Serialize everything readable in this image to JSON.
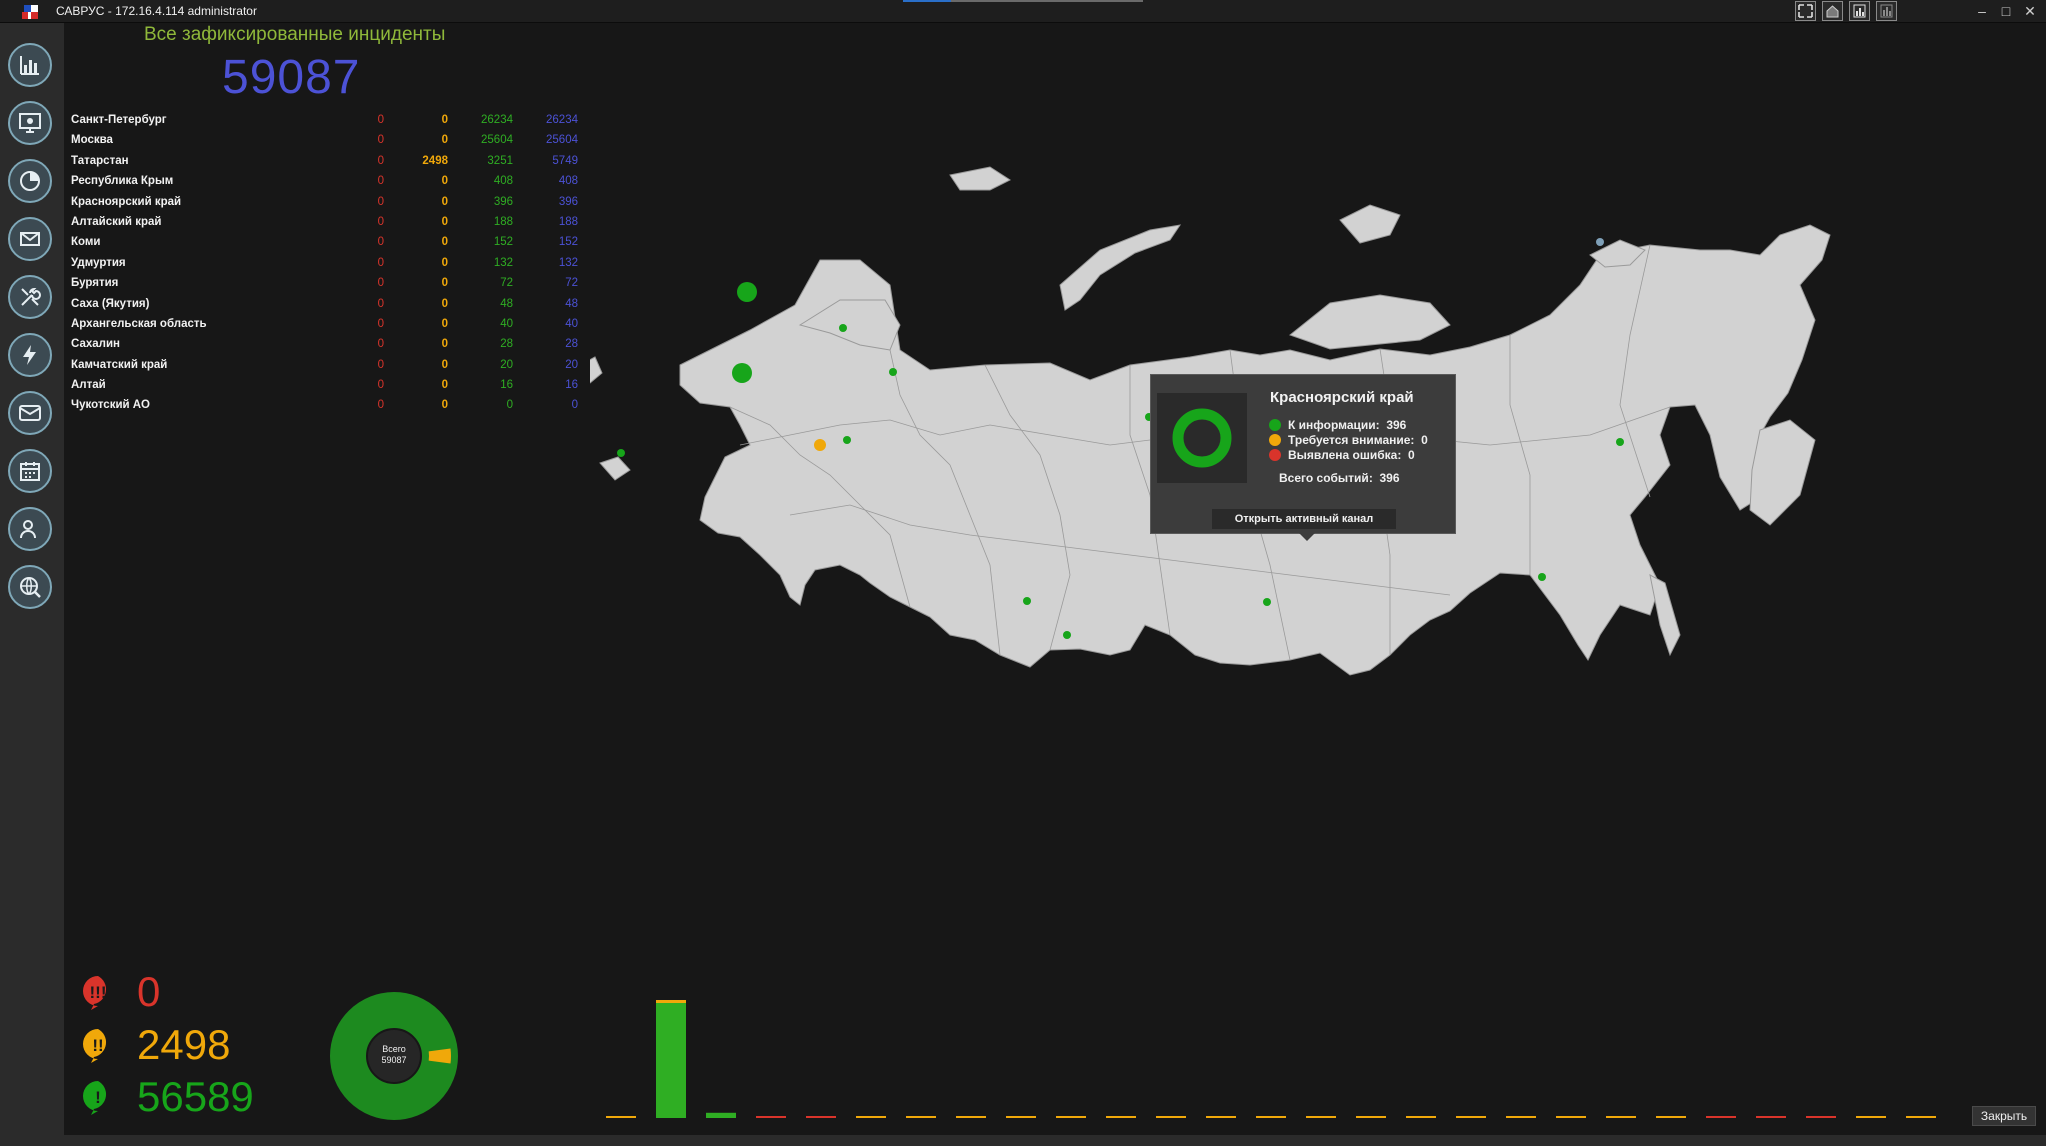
{
  "window": {
    "title": "САВРУС - 172.16.4.114 administrator",
    "minimize": "–",
    "maximize": "□",
    "close": "✕"
  },
  "sidebar": {
    "items": [
      "dashboard-chart-icon",
      "monitor-icon",
      "pie-chart-icon",
      "mail-network-icon",
      "tools-icon",
      "lightning-icon",
      "message-icon",
      "calendar-icon",
      "user-search-icon",
      "globe-search-icon"
    ]
  },
  "header": {
    "title": "Все зафиксированные инциденты",
    "total": "59087"
  },
  "regions": [
    {
      "name": "Санкт-Петербург",
      "errors": "0",
      "warnings": "0",
      "info": "26234",
      "total": "26234"
    },
    {
      "name": "Москва",
      "errors": "0",
      "warnings": "0",
      "info": "25604",
      "total": "25604"
    },
    {
      "name": "Татарстан",
      "errors": "0",
      "warnings": "2498",
      "info": "3251",
      "total": "5749"
    },
    {
      "name": "Республика Крым",
      "errors": "0",
      "warnings": "0",
      "info": "408",
      "total": "408"
    },
    {
      "name": "Красноярский край",
      "errors": "0",
      "warnings": "0",
      "info": "396",
      "total": "396"
    },
    {
      "name": "Алтайский край",
      "errors": "0",
      "warnings": "0",
      "info": "188",
      "total": "188"
    },
    {
      "name": "Коми",
      "errors": "0",
      "warnings": "0",
      "info": "152",
      "total": "152"
    },
    {
      "name": "Удмуртия",
      "errors": "0",
      "warnings": "0",
      "info": "132",
      "total": "132"
    },
    {
      "name": "Бурятия",
      "errors": "0",
      "warnings": "0",
      "info": "72",
      "total": "72"
    },
    {
      "name": "Саха (Якутия)",
      "errors": "0",
      "warnings": "0",
      "info": "48",
      "total": "48"
    },
    {
      "name": "Архангельская область",
      "errors": "0",
      "warnings": "0",
      "info": "40",
      "total": "40"
    },
    {
      "name": "Сахалин",
      "errors": "0",
      "warnings": "0",
      "info": "28",
      "total": "28"
    },
    {
      "name": "Камчатский край",
      "errors": "0",
      "warnings": "0",
      "info": "20",
      "total": "20"
    },
    {
      "name": "Алтай",
      "errors": "0",
      "warnings": "0",
      "info": "16",
      "total": "16"
    },
    {
      "name": "Чукотский АО",
      "errors": "0",
      "warnings": "0",
      "info": "0",
      "total": "0"
    }
  ],
  "tooltip": {
    "region": "Красноярский край",
    "info_label": "К информации:",
    "info_value": "396",
    "attention_label": "Требуется внимание:",
    "attention_value": "0",
    "error_label": "Выявлена ошибка:",
    "error_value": "0",
    "total_label": "Всего событий:",
    "total_value": "396",
    "open_button": "Открыть активный канал"
  },
  "summary": {
    "errors": "0",
    "warnings": "2498",
    "info": "56589",
    "donut_label": "Всего",
    "donut_total": "59087"
  },
  "colors": {
    "error": "#d9342b",
    "warning": "#f0a80a",
    "info": "#2fae23",
    "total": "#4c52d6",
    "map_land": "#d2d2d2",
    "map_border": "#9a9a9a"
  },
  "chart_data": {
    "type": "bar",
    "values": [
      0,
      56589,
      2498,
      0,
      0,
      0,
      0,
      0,
      0,
      0,
      0,
      0,
      0,
      0,
      0,
      0,
      0,
      0,
      0,
      0,
      0,
      0,
      0,
      0,
      0,
      0,
      0
    ],
    "colors": [
      "#f0a80a",
      "#2fae23",
      "#2fae23",
      "#d9342b",
      "#d9342b",
      "#f0a80a",
      "#f0a80a",
      "#f0a80a",
      "#f0a80a",
      "#f0a80a",
      "#f0a80a",
      "#f0a80a",
      "#f0a80a",
      "#f0a80a",
      "#f0a80a",
      "#f0a80a",
      "#f0a80a",
      "#f0a80a",
      "#f0a80a",
      "#f0a80a",
      "#f0a80a",
      "#f0a80a",
      "#d9342b",
      "#d9342b",
      "#d9342b",
      "#f0a80a",
      "#f0a80a"
    ]
  },
  "close_button": "Закрыть"
}
